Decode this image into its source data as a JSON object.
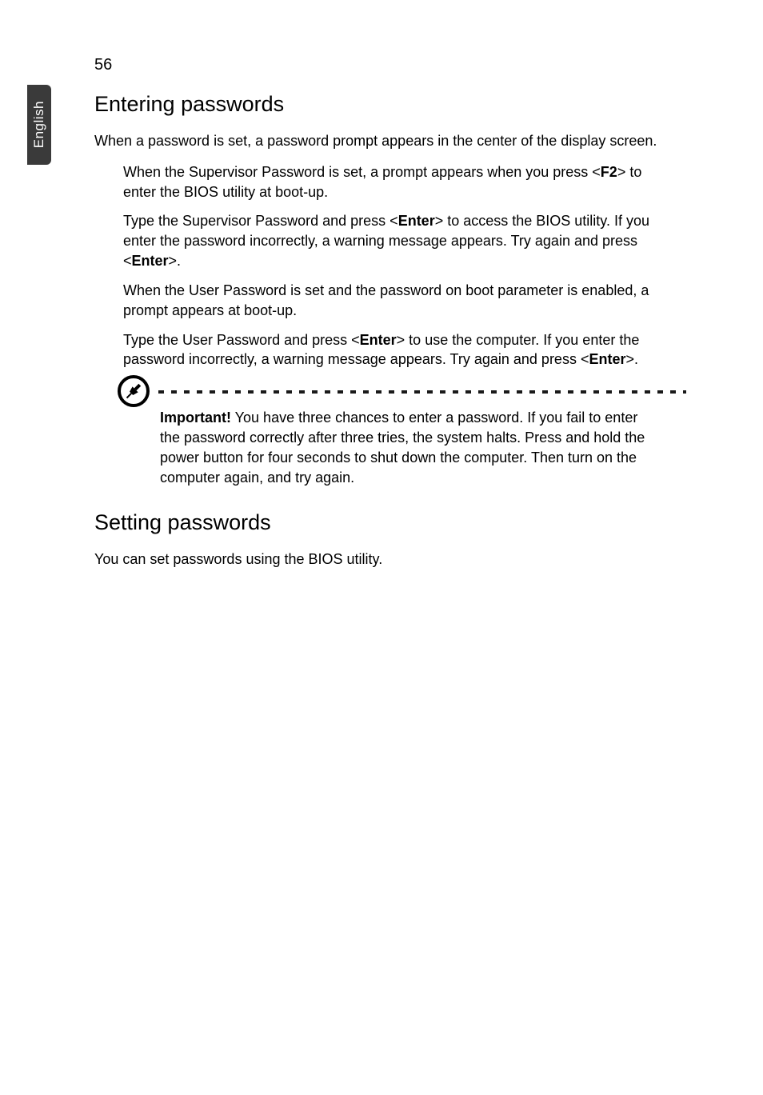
{
  "side_tab": {
    "label": "English"
  },
  "page_number": "56",
  "sections": {
    "entering": {
      "heading": "Entering passwords",
      "intro": "When a password is set, a password prompt appears in the center of the display screen.",
      "items": {
        "a_pre": "When the Supervisor Password is set, a prompt appears when you press <",
        "a_key": "F2",
        "a_post": "> to enter the BIOS utility at boot-up.",
        "b_pre": "Type the Supervisor Password and press <",
        "b_key": "Enter",
        "b_mid": "> to access the BIOS utility. If you enter the password incorrectly, a warning message appears. Try again and press <",
        "b_key2": "Enter",
        "b_post": ">.",
        "c": "When the User Password is set and the password on boot parameter is enabled, a prompt appears at boot-up.",
        "d_pre": "Type the User Password and press <",
        "d_key": "Enter",
        "d_mid": "> to use the computer. If you enter the password incorrectly, a warning message appears. Try again and press <",
        "d_key2": "Enter",
        "d_post": ">."
      },
      "callout": {
        "label": "Important!",
        "text": " You have three chances to enter a password. If you fail to enter the password correctly after three tries, the system halts. Press and hold the power button for four seconds to shut down the computer. Then turn on the computer again, and try again."
      }
    },
    "setting": {
      "heading": "Setting passwords",
      "text": "You can set passwords using the BIOS utility."
    }
  }
}
